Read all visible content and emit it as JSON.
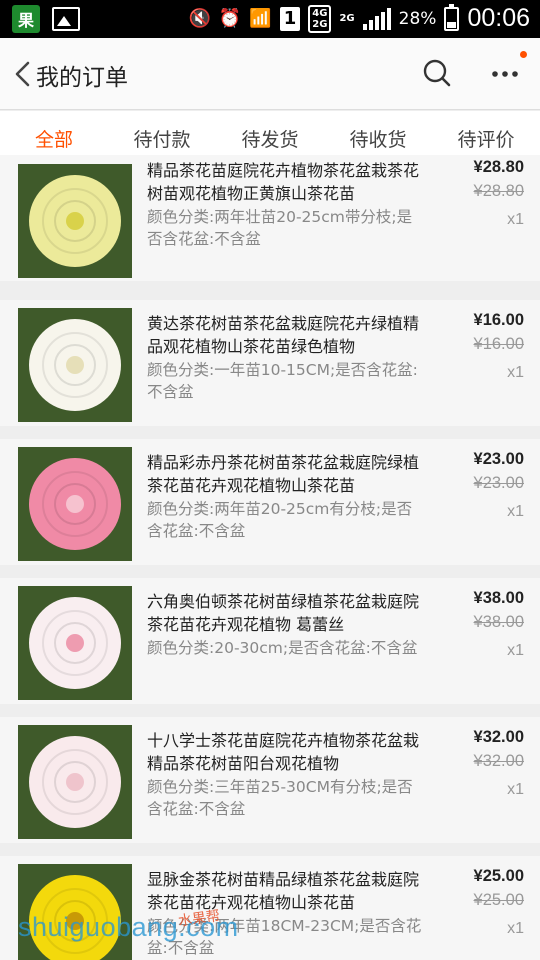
{
  "status_bar": {
    "app_badge": "果",
    "battery_percent": "28%",
    "time": "00:06",
    "network_4g": "4G",
    "network_2g": "2G",
    "network_2g_label": "2G",
    "sim_slot": "1"
  },
  "header": {
    "title": "我的订单"
  },
  "tabs": [
    {
      "label": "全部",
      "active": true
    },
    {
      "label": "待付款",
      "active": false
    },
    {
      "label": "待发货",
      "active": false
    },
    {
      "label": "待收货",
      "active": false
    },
    {
      "label": "待评价",
      "active": false
    }
  ],
  "orders": [
    {
      "title": "精品茶花苗庭院花卉植物茶花盆栽茶花树苗观花植物正黄旗山茶花苗",
      "specs": "颜色分类:两年壮苗20-25cm带分枝;是否含花盆:不含盆",
      "price": "¥28.80",
      "original_price": "¥28.80",
      "quantity": "x1",
      "flower_color": "#ecea9a",
      "flower_center": "#d9d24a"
    },
    {
      "title": "黄达茶花树苗茶花盆栽庭院花卉绿植精品观花植物山茶花苗绿色植物",
      "specs": "颜色分类:一年苗10-15CM;是否含花盆:不含盆",
      "price": "¥16.00",
      "original_price": "¥16.00",
      "quantity": "x1",
      "flower_color": "#f7f5ec",
      "flower_center": "#e6dfb8"
    },
    {
      "title": "精品彩赤丹茶花树苗茶花盆栽庭院绿植茶花苗花卉观花植物山茶花苗",
      "specs": "颜色分类:两年苗20-25cm有分枝;是否含花盆:不含盆",
      "price": "¥23.00",
      "original_price": "¥23.00",
      "quantity": "x1",
      "flower_color": "#f08aa6",
      "flower_center": "#f6c2cf"
    },
    {
      "title": "六角奥伯顿茶花树苗绿植茶花盆栽庭院茶花苗花卉观花植物 葛蕾丝",
      "specs": "颜色分类:20-30cm;是否含花盆:不含盆",
      "price": "¥38.00",
      "original_price": "¥38.00",
      "quantity": "x1",
      "flower_color": "#f9eef0",
      "flower_center": "#ee9cb0"
    },
    {
      "title": "十八学士茶花苗庭院花卉植物茶花盆栽精品茶花树苗阳台观花植物",
      "specs": "颜色分类:三年苗25-30CM有分枝;是否含花盆:不含盆",
      "price": "¥32.00",
      "original_price": "¥32.00",
      "quantity": "x1",
      "flower_color": "#f9eaec",
      "flower_center": "#efc4cc"
    },
    {
      "title": "显脉金茶花树苗精品绿植茶花盆栽庭院茶花苗花卉观花植物山茶花苗",
      "specs": "颜色分类:两年苗18CM-23CM;是否含花盆:不含盆",
      "price": "¥25.00",
      "original_price": "¥25.00",
      "quantity": "x1",
      "flower_color": "#f3d90c",
      "flower_center": "#c89a06"
    }
  ],
  "watermark": {
    "text": "shuiguobang.com",
    "text_cn": "水果帮"
  }
}
